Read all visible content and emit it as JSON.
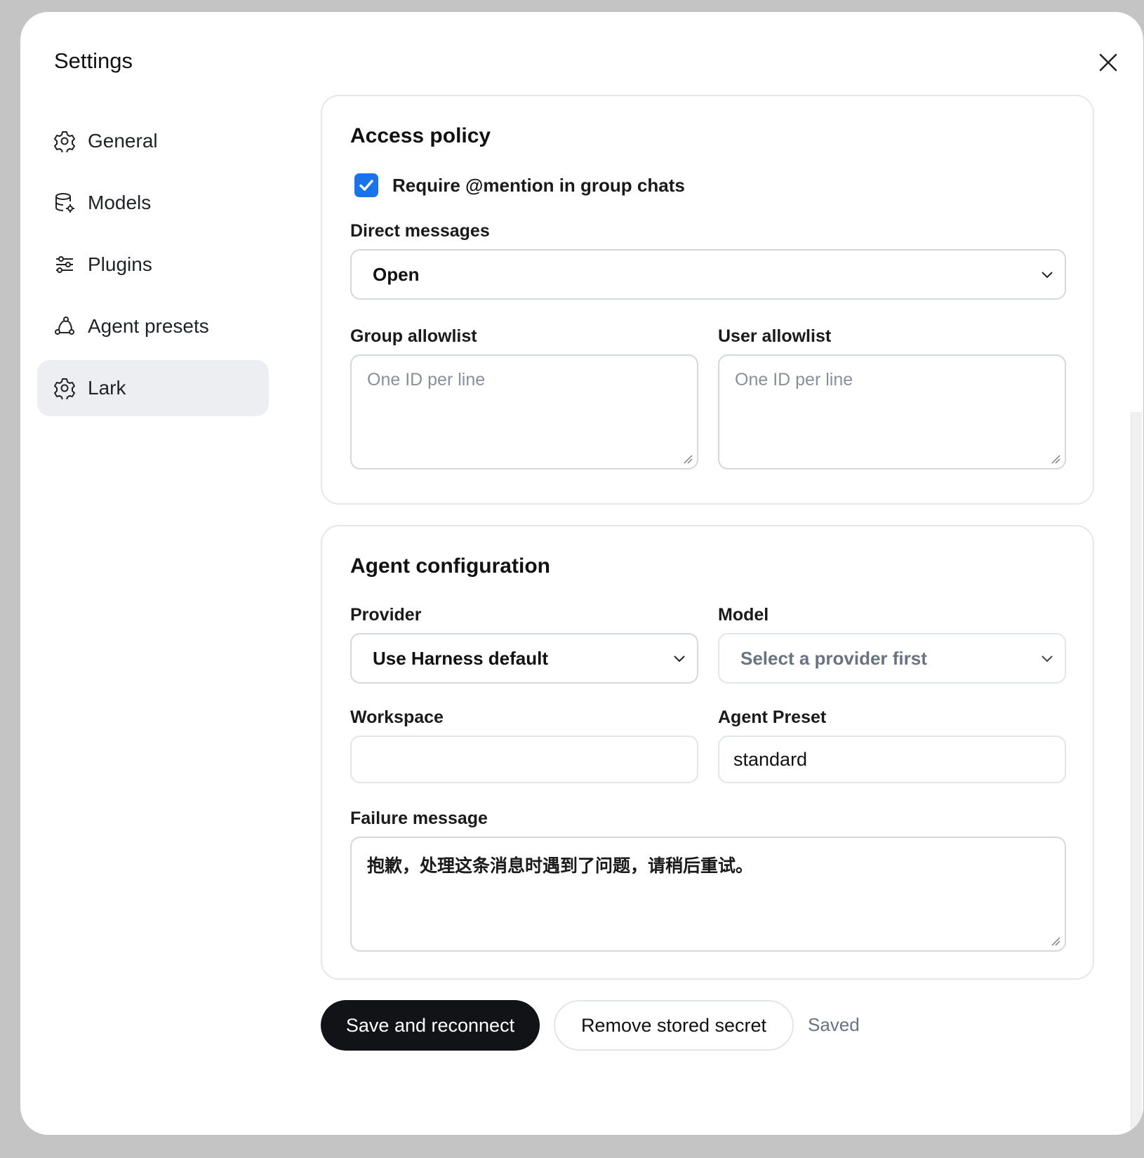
{
  "modal": {
    "title": "Settings",
    "close_icon": "close-icon"
  },
  "sidebar": {
    "items": [
      {
        "label": "General",
        "icon": "gear-icon",
        "active": false
      },
      {
        "label": "Models",
        "icon": "database-gear-icon",
        "active": false
      },
      {
        "label": "Plugins",
        "icon": "sliders-icon",
        "active": false
      },
      {
        "label": "Agent presets",
        "icon": "agent-nodes-icon",
        "active": false
      },
      {
        "label": "Lark",
        "icon": "gear-icon",
        "active": true
      }
    ]
  },
  "access_policy": {
    "title": "Access policy",
    "require_mention": {
      "label": "Require @mention in group chats",
      "checked": true
    },
    "direct_messages": {
      "label": "Direct messages",
      "value": "Open"
    },
    "group_allowlist": {
      "label": "Group allowlist",
      "placeholder": "One ID per line",
      "value": ""
    },
    "user_allowlist": {
      "label": "User allowlist",
      "placeholder": "One ID per line",
      "value": ""
    }
  },
  "agent_configuration": {
    "title": "Agent configuration",
    "provider": {
      "label": "Provider",
      "value": "Use Harness default"
    },
    "model": {
      "label": "Model",
      "placeholder": "Select a provider first"
    },
    "workspace": {
      "label": "Workspace",
      "value": ""
    },
    "agent_preset": {
      "label": "Agent Preset",
      "value": "standard"
    },
    "failure_message": {
      "label": "Failure message",
      "value": "抱歉，处理这条消息时遇到了问题，请稍后重试。"
    }
  },
  "actions": {
    "save_label": "Save and reconnect",
    "remove_label": "Remove stored secret",
    "status": "Saved"
  },
  "colors": {
    "accent": "#1a73e8",
    "primary_button": "#121316",
    "active_nav": "#eceef2"
  }
}
